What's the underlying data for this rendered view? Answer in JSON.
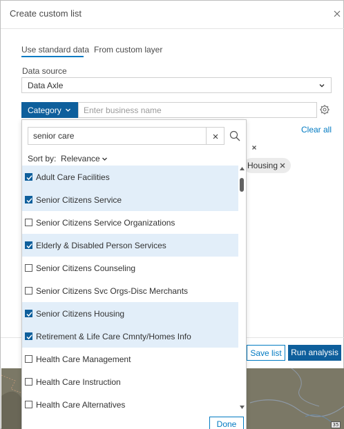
{
  "dialog": {
    "title": "Create custom list"
  },
  "tabs": [
    {
      "label": "Use standard data",
      "active": true
    },
    {
      "label": "From custom layer",
      "active": false
    }
  ],
  "data_source": {
    "label": "Data source",
    "value": "Data Axle"
  },
  "search_bar": {
    "category_label": "Category",
    "placeholder": "Enter business name"
  },
  "clear_all": "Clear all",
  "chips": [
    {
      "label": "Housing"
    }
  ],
  "footer": {
    "save_label": "Save list",
    "run_label": "Run analysis"
  },
  "map": {
    "badge": "35"
  },
  "dropdown": {
    "search_value": "senior care",
    "sort_label": "Sort by:",
    "sort_value": "Relevance",
    "items": [
      {
        "label": "Adult Care Facilities",
        "checked": true
      },
      {
        "label": "Senior Citizens Service",
        "checked": true
      },
      {
        "label": "Senior Citizens Service Organizations",
        "checked": false
      },
      {
        "label": "Elderly & Disabled Person Services",
        "checked": true
      },
      {
        "label": "Senior Citizens Counseling",
        "checked": false
      },
      {
        "label": "Senior Citizens Svc Orgs-Disc Merchants",
        "checked": false
      },
      {
        "label": "Senior Citizens Housing",
        "checked": true
      },
      {
        "label": "Retirement & Life Care Cmnty/Homes Info",
        "checked": true
      },
      {
        "label": "Health Care Management",
        "checked": false
      },
      {
        "label": "Health Care Instruction",
        "checked": false
      },
      {
        "label": "Health Care Alternatives",
        "checked": false
      }
    ],
    "done_label": "Done"
  },
  "colors": {
    "accent": "#007ac2",
    "button_dark": "#0e5f9c",
    "selected_row": "#e2eef9"
  }
}
